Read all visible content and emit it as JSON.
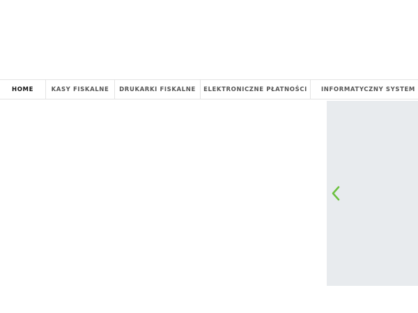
{
  "nav": {
    "items": [
      {
        "label": "HOME",
        "active": true
      },
      {
        "label": "KASY FISKALNE",
        "active": false
      },
      {
        "label": "DRUKARKI FISKALNE",
        "active": false
      },
      {
        "label": "ELEKTRONICZNE PŁATNOŚCI",
        "active": false
      },
      {
        "label": "INFORMATYCZNY SYSTEM SPRZ",
        "active": false
      }
    ]
  },
  "slider": {
    "prev_icon": "chevron-left-icon",
    "accent_color": "#6cc13f",
    "panel_color": "#e8ebee"
  }
}
